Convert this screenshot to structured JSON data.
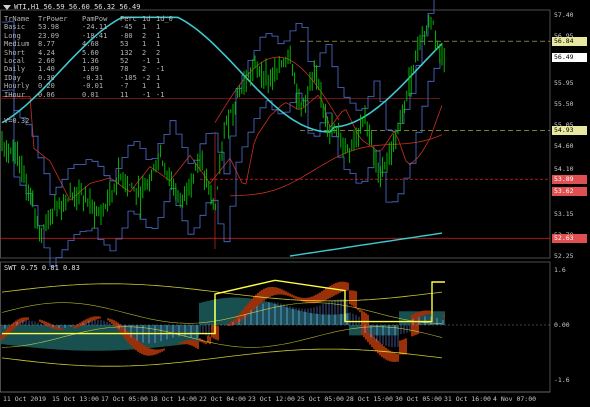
{
  "header": {
    "symbol_line": "WTI,H1  56.59 56.60 56.32 56.49",
    "swt_line": "SWT 0.75 0.81 0.83",
    "extra_line": "V=0.32"
  },
  "table": {
    "headers": [
      "TrName",
      "TrPower",
      "PamPow",
      "Perc",
      "1d",
      "1d_0"
    ],
    "rows": [
      [
        "Basic",
        "53.98",
        "-24.11",
        "-45",
        "1",
        "1"
      ],
      [
        "Long",
        "23.09",
        "-18.41",
        "-80",
        "2",
        "1"
      ],
      [
        "Medium",
        "8.77",
        "4.68",
        "53",
        "1",
        "1"
      ],
      [
        "Short",
        "4.24",
        "5.60",
        "132",
        "2",
        "2"
      ],
      [
        "Local",
        "2.60",
        "1.36",
        "52",
        "-1",
        "1"
      ],
      [
        "Daily",
        "1.40",
        "1.09",
        "78",
        "2",
        "-1"
      ],
      [
        "IDay",
        "0.30",
        "-0.31",
        "-105",
        "-2",
        "1"
      ],
      [
        "Hourly",
        "0.20",
        "-0.01",
        "-7",
        "1",
        "1"
      ],
      [
        "IHour",
        "0.06",
        "0.01",
        "11",
        "-1",
        "-1"
      ]
    ]
  },
  "price_axis": [
    "57.40",
    "56.95",
    "56.49",
    "55.95",
    "55.50",
    "55.05",
    "54.60",
    "54.10",
    "53.65",
    "53.15",
    "52.70",
    "52.25"
  ],
  "price_badges": [
    {
      "label": "56.84",
      "color": "#e8e8a0"
    },
    {
      "label": "56.49",
      "color": "#ffffff"
    },
    {
      "label": "54.93",
      "color": "#e8e8a0"
    },
    {
      "label": "53.89",
      "color": "#e05050"
    },
    {
      "label": "53.62",
      "color": "#e05050"
    },
    {
      "label": "52.63",
      "color": "#e05050"
    }
  ],
  "swt_axis": [
    "1.6",
    "0.00",
    "-1.6"
  ],
  "time_axis": [
    "11 Oct 2019",
    "15 Oct 13:00",
    "17 Oct 05:00",
    "18 Oct 14:00",
    "22 Oct 04:00",
    "23 Oct 12:00",
    "25 Oct 05:00",
    "28 Oct 15:00",
    "30 Oct 05:00",
    "31 Oct 16:00",
    "4 Nov 07:00"
  ],
  "colors": {
    "candle": "#00c800",
    "ma_cyan": "#40c8d0",
    "line_red": "#c83020",
    "line_blue": "#5070d0",
    "level_red": "#e02020",
    "level_yellow": "#c8c850",
    "swt_teal": "#30a0a0",
    "swt_orange": "#ff5010",
    "swt_blue": "#6080d0",
    "swt_yellow": "#ffff40"
  }
}
